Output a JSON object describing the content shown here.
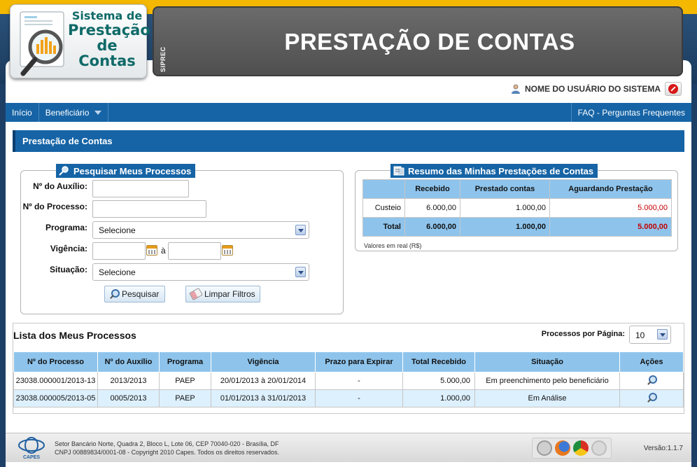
{
  "header": {
    "logo_line1": "Sistema de",
    "logo_line2": "Prestação",
    "logo_line3": "de Contas",
    "system_code": "SIPREC",
    "page_banner": "PRESTAÇÃO DE CONTAS",
    "user_name": "NOME DO USUÁRIO DO SISTEMA"
  },
  "nav": {
    "home": "Início",
    "beneficiary": "Beneficiário",
    "faq": "FAQ - Perguntas Frequentes"
  },
  "section_title": "Prestação de Contas",
  "search": {
    "legend": "Pesquisar Meus Processos",
    "aux_label": "Nº do Auxílio:",
    "proc_label": "Nº do Processo:",
    "program_label": "Programa:",
    "program_value": "Selecione",
    "vig_label": "Vigência:",
    "vig_sep": "à",
    "status_label": "Situação:",
    "status_value": "Selecione",
    "search_btn": "Pesquisar",
    "clear_btn": "Limpar Filtros"
  },
  "summary": {
    "legend": "Resumo das Minhas Prestações de Contas",
    "headers": [
      "",
      "Recebido",
      "Prestado contas",
      "Aguardando Prestação"
    ],
    "rows": [
      {
        "label": "Custeio",
        "received": "6.000,00",
        "rendered": "1.000,00",
        "pending": "5.000,00"
      }
    ],
    "total": {
      "label": "Total",
      "received": "6.000,00",
      "rendered": "1.000,00",
      "pending": "5.000,00"
    },
    "note": "Valores em real (R$)"
  },
  "list": {
    "title": "Lista dos Meus Processos",
    "per_page_label": "Processos por Página:",
    "per_page_value": "10",
    "headers": [
      "Nº do Processo",
      "Nº do Auxílio",
      "Programa",
      "Vigência",
      "Prazo para Expirar",
      "Total Recebido",
      "Situação",
      "Ações"
    ],
    "rows": [
      {
        "proc": "23038.000001/2013-13",
        "aux": "2013/2013",
        "program": "PAEP",
        "vig": "20/01/2013 à 20/01/2014",
        "expire": "-",
        "total": "5.000,00",
        "status": "Em preenchimento pelo beneficiário"
      },
      {
        "proc": "23038.000005/2013-05",
        "aux": "0005/2013",
        "program": "PAEP",
        "vig": "01/01/2013 à 31/01/2013",
        "expire": "-",
        "total": "1.000,00",
        "status": "Em Análise"
      }
    ]
  },
  "footer": {
    "address": "Setor Bancário Norte, Quadra 2, Bloco L, Lote 06, CEP 70040-020 - Brasília, DF",
    "cnpj": "CNPJ 00889834/0001-08 - Copyright 2010 Capes. Todos os direitos reservados.",
    "capes": "CAPES",
    "version": "Versão:1.1.7"
  },
  "colors": {
    "accent_blue": "#1664a6",
    "header_yellow": "#f4b800",
    "table_header": "#8ec4ec",
    "pending_red": "#c40000"
  }
}
